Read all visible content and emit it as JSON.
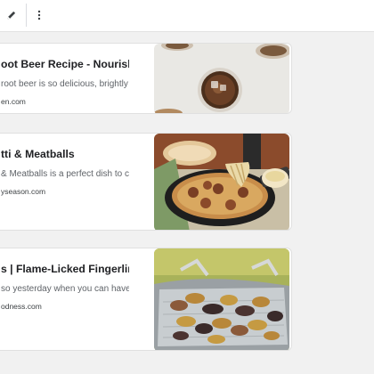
{
  "toolbar": {
    "edit_icon": "pencil-icon",
    "more_icon": "more-vertical-icon"
  },
  "results": [
    {
      "title": "oot Beer Recipe - Nourished K…",
      "description": "root beer is so delicious, brightly fl…",
      "source": "en.com",
      "image": "root-beer-image"
    },
    {
      "title": "tti & Meatballs",
      "description": "& Meatballs is a perfect dish to co…",
      "source": "yseason.com",
      "image": "spaghetti-meatballs-skillet-image"
    },
    {
      "title": "s | Flame-Licked Fingerling Po…",
      "description": "so yesterday when you can have g…",
      "source": "odness.com",
      "image": "grilled-fingerling-potatoes-image"
    }
  ]
}
